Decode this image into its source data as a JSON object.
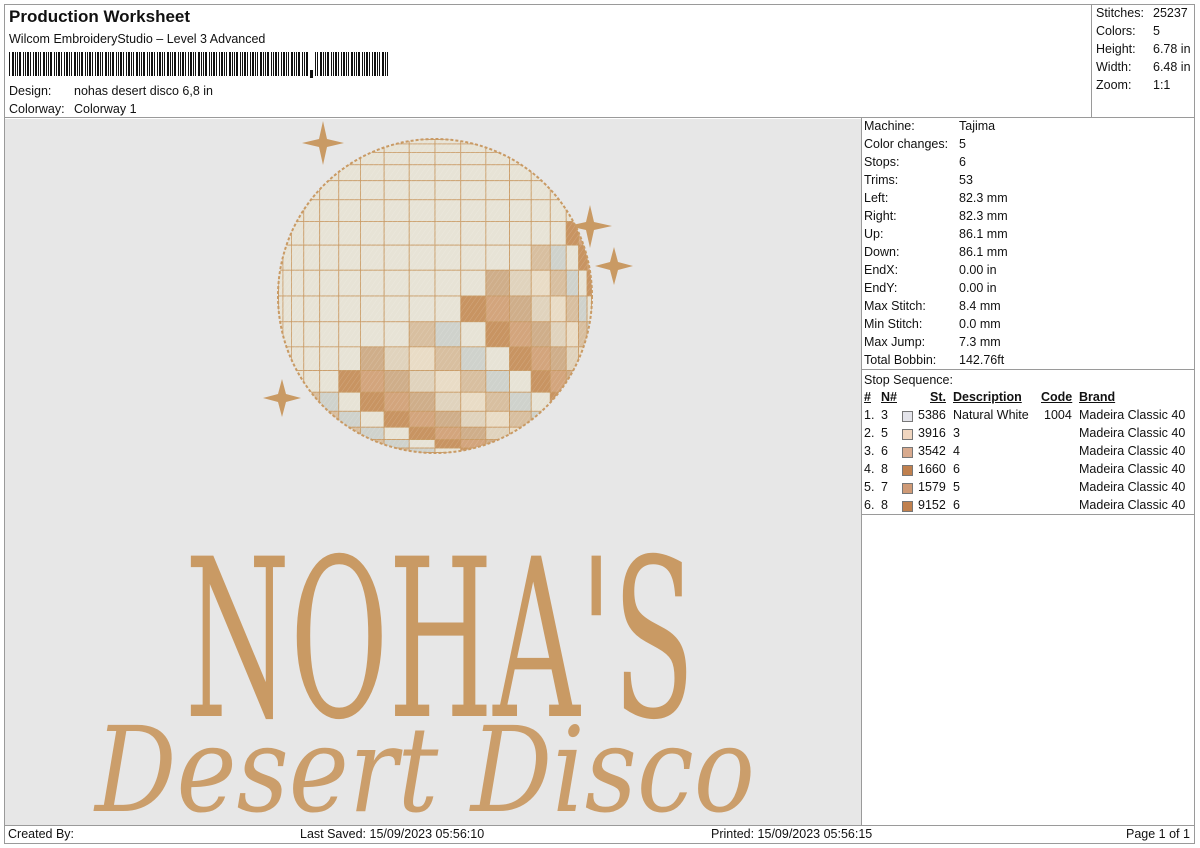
{
  "header": {
    "title": "Production Worksheet",
    "software": "Wilcom EmbroideryStudio – Level 3 Advanced",
    "design_label": "Design:",
    "design_value": "nohas desert disco 6,8 in",
    "colorway_label": "Colorway:",
    "colorway_value": "Colorway 1"
  },
  "stats": [
    {
      "label": "Stitches:",
      "value": "25237"
    },
    {
      "label": "Colors:",
      "value": "5"
    },
    {
      "label": "Height:",
      "value": "6.78 in"
    },
    {
      "label": "Width:",
      "value": "6.48 in"
    },
    {
      "label": "Zoom:",
      "value": "1:1"
    }
  ],
  "properties": [
    {
      "label": "Machine:",
      "value": "Tajima"
    },
    {
      "label": "Color changes:",
      "value": "5"
    },
    {
      "label": "Stops:",
      "value": "6"
    },
    {
      "label": "Trims:",
      "value": "53"
    },
    {
      "label": "Left:",
      "value": "82.3 mm"
    },
    {
      "label": "Right:",
      "value": "82.3 mm"
    },
    {
      "label": "Up:",
      "value": "86.1 mm"
    },
    {
      "label": "Down:",
      "value": "86.1 mm"
    },
    {
      "label": "EndX:",
      "value": "0.00 in"
    },
    {
      "label": "EndY:",
      "value": "0.00 in"
    },
    {
      "label": "Max Stitch:",
      "value": "8.4 mm"
    },
    {
      "label": "Min Stitch:",
      "value": "0.0 mm"
    },
    {
      "label": "Max Jump:",
      "value": "7.3 mm"
    },
    {
      "label": "Total Bobbin:",
      "value": "142.76ft"
    }
  ],
  "stop_sequence": {
    "title": "Stop Sequence:",
    "headers": {
      "n": "#",
      "num": "N#",
      "st": "St.",
      "description": "Description",
      "code": "Code",
      "brand": "Brand"
    },
    "rows": [
      {
        "n": "1.",
        "num": "3",
        "color": "#e4e4ea",
        "st": "5386",
        "description": "Natural White",
        "code": "1004",
        "brand": "Madeira Classic 40"
      },
      {
        "n": "2.",
        "num": "5",
        "color": "#f0d6c0",
        "st": "3916",
        "description": "3",
        "code": "",
        "brand": "Madeira Classic 40"
      },
      {
        "n": "3.",
        "num": "6",
        "color": "#d8aa8e",
        "st": "3542",
        "description": "4",
        "code": "",
        "brand": "Madeira Classic 40"
      },
      {
        "n": "4.",
        "num": "8",
        "color": "#c0804e",
        "st": "1660",
        "description": "6",
        "code": "",
        "brand": "Madeira Classic 40"
      },
      {
        "n": "5.",
        "num": "7",
        "color": "#cf9a76",
        "st": "1579",
        "description": "5",
        "code": "",
        "brand": "Madeira Classic 40"
      },
      {
        "n": "6.",
        "num": "8",
        "color": "#c0804e",
        "st": "9152",
        "description": "6",
        "code": "",
        "brand": "Madeira Classic 40"
      }
    ]
  },
  "design_preview": {
    "brand_text": "NOHA'S",
    "script_text": "Desert Disco",
    "thread_color": "#c99a64",
    "background_color": "#e7e7e7"
  },
  "footer": {
    "created_by_label": "Created By:",
    "last_saved": "Last Saved: 15/09/2023 05:56:10",
    "printed": "Printed: 15/09/2023 05:56:15",
    "page": "Page 1 of 1"
  }
}
